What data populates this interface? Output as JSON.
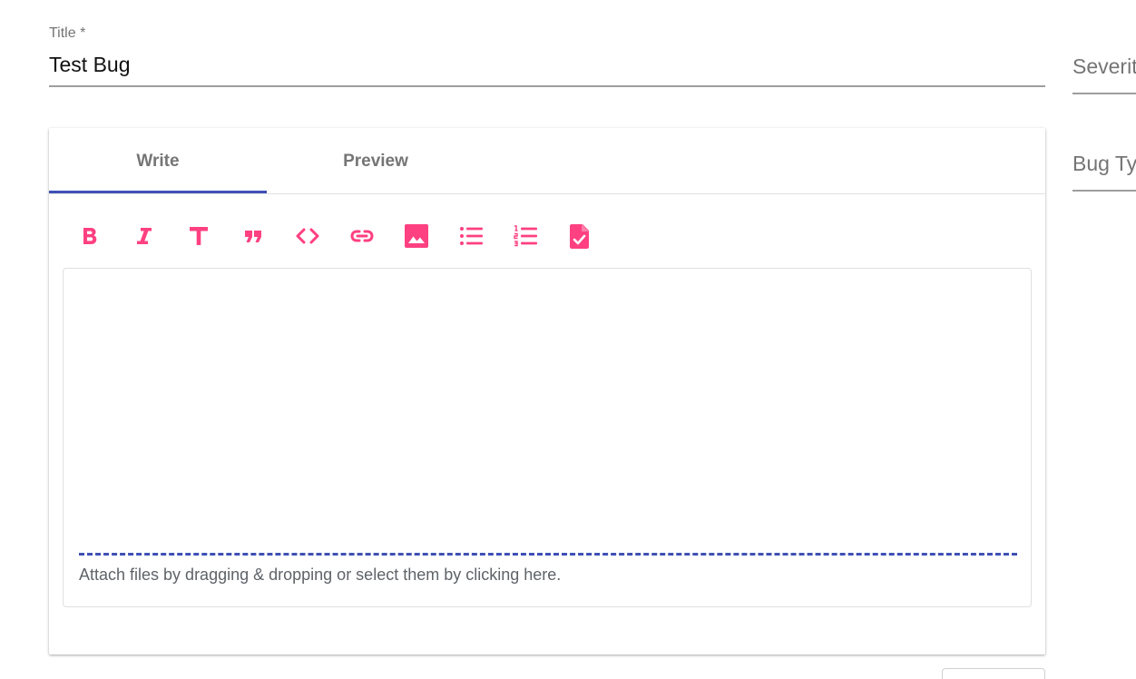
{
  "title_field": {
    "label": "Title *",
    "value": "Test Bug"
  },
  "side_fields": {
    "severity_label": "Severity",
    "bug_type_label": "Bug Type"
  },
  "editor": {
    "tabs": [
      {
        "label": "Write",
        "active": true
      },
      {
        "label": "Preview",
        "active": false
      }
    ],
    "toolbar": [
      {
        "icon": "bold-icon",
        "title": "Add bold text"
      },
      {
        "icon": "italic-icon",
        "title": "Add italic text"
      },
      {
        "icon": "header-icon",
        "title": "Add header text"
      },
      {
        "icon": "quote-icon",
        "title": "Insert a quote"
      },
      {
        "icon": "code-icon",
        "title": "Insert code"
      },
      {
        "icon": "link-icon",
        "title": "Add a link"
      },
      {
        "icon": "image-icon",
        "title": "Add image"
      },
      {
        "icon": "unordered-list-icon",
        "title": "Add a bulleted list"
      },
      {
        "icon": "ordered-list-icon",
        "title": "Add a numbered list"
      },
      {
        "icon": "checked-list-icon",
        "title": "Add a task list"
      }
    ],
    "textarea_value": "",
    "attach_hint": "Attach files by dragging & dropping or select them by clicking here."
  },
  "colors": {
    "accent_pink": "#ff4081",
    "indicator_indigo": "#3f51b5",
    "label_gray": "#757575"
  }
}
